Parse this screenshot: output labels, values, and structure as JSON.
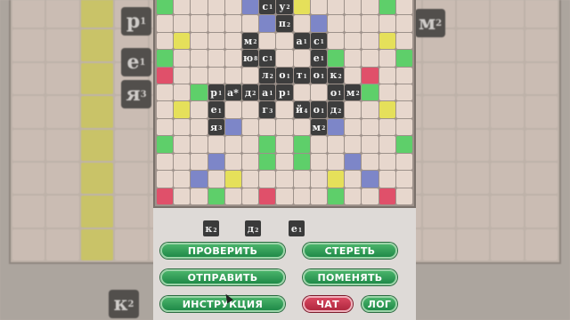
{
  "background": {
    "tiles": [
      {
        "letter": "р",
        "score": "1"
      },
      {
        "letter": "е",
        "score": "1"
      },
      {
        "letter": "я",
        "score": "3"
      },
      {
        "letter": "м",
        "score": "2"
      },
      {
        "letter": "к",
        "score": "2"
      }
    ]
  },
  "board": {
    "rows": 12,
    "cols": 15,
    "premium_colors": {
      "g": "#5ecf6a",
      "r": "#e0506a",
      "y": "#e5e05a",
      "b": "#7d86c8"
    },
    "layout": [
      "g....b..y....g.",
      "......b..b.....",
      ".y...........y.",
      "g.....g...g...g",
      "r...........r..",
      "..g.g.....g.g..",
      ".y...........y.",
      "....b.....b....",
      "g.....g.g.....g",
      "...b..g.g..b...",
      "..b.y.....y.b..",
      "r..g..r...g..r."
    ],
    "tiles": [
      {
        "r": 0,
        "c": 6,
        "letter": "с",
        "score": "1"
      },
      {
        "r": 0,
        "c": 7,
        "letter": "у",
        "score": "2"
      },
      {
        "r": 1,
        "c": 7,
        "letter": "п",
        "score": "2"
      },
      {
        "r": 2,
        "c": 5,
        "letter": "м",
        "score": "2"
      },
      {
        "r": 2,
        "c": 8,
        "letter": "а",
        "score": "1"
      },
      {
        "r": 2,
        "c": 9,
        "letter": "с",
        "score": "1"
      },
      {
        "r": 3,
        "c": 5,
        "letter": "ю",
        "score": "8"
      },
      {
        "r": 3,
        "c": 6,
        "letter": "с",
        "score": "1"
      },
      {
        "r": 3,
        "c": 9,
        "letter": "е",
        "score": "1"
      },
      {
        "r": 4,
        "c": 6,
        "letter": "л",
        "score": "2"
      },
      {
        "r": 4,
        "c": 7,
        "letter": "о",
        "score": "1"
      },
      {
        "r": 4,
        "c": 8,
        "letter": "т",
        "score": "1"
      },
      {
        "r": 4,
        "c": 9,
        "letter": "о",
        "score": "1"
      },
      {
        "r": 4,
        "c": 10,
        "letter": "к",
        "score": "2"
      },
      {
        "r": 5,
        "c": 3,
        "letter": "р",
        "score": "1"
      },
      {
        "r": 5,
        "c": 4,
        "letter": "а*",
        "score": ""
      },
      {
        "r": 5,
        "c": 5,
        "letter": "д",
        "score": "2"
      },
      {
        "r": 5,
        "c": 6,
        "letter": "а",
        "score": "1"
      },
      {
        "r": 5,
        "c": 7,
        "letter": "р",
        "score": "1"
      },
      {
        "r": 5,
        "c": 10,
        "letter": "о",
        "score": "1"
      },
      {
        "r": 5,
        "c": 11,
        "letter": "м",
        "score": "2"
      },
      {
        "r": 6,
        "c": 3,
        "letter": "е",
        "score": "1"
      },
      {
        "r": 6,
        "c": 6,
        "letter": "г",
        "score": "3"
      },
      {
        "r": 6,
        "c": 8,
        "letter": "й",
        "score": "4"
      },
      {
        "r": 6,
        "c": 9,
        "letter": "о",
        "score": "1"
      },
      {
        "r": 6,
        "c": 10,
        "letter": "д",
        "score": "2"
      },
      {
        "r": 7,
        "c": 3,
        "letter": "я",
        "score": "3"
      },
      {
        "r": 7,
        "c": 9,
        "letter": "м",
        "score": "2"
      }
    ]
  },
  "rack": [
    {
      "letter": "к",
      "score": "2"
    },
    {
      "letter": "д",
      "score": "2"
    },
    {
      "letter": "е",
      "score": "1"
    }
  ],
  "buttons": {
    "check": "ПРОВЕРИТЬ",
    "erase": "СТЕРЕТЬ",
    "send": "ОТПРАВИТЬ",
    "swap": "ПОМЕНЯТЬ",
    "instructions": "ИНСТРУКЦИЯ",
    "chat": "ЧАТ",
    "log": "ЛОГ"
  }
}
